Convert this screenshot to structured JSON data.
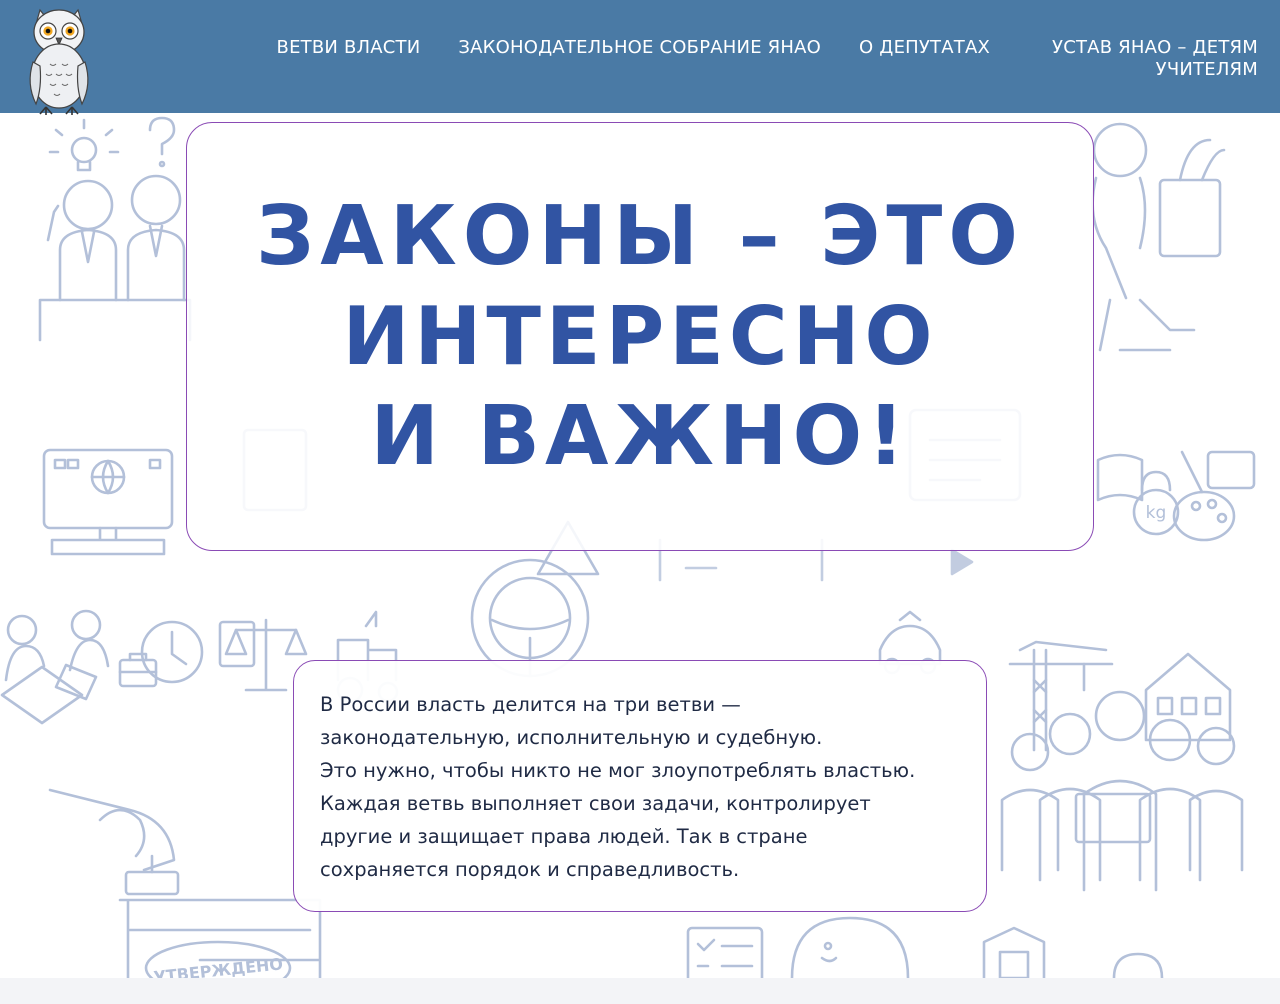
{
  "header": {
    "logo_icon": "owl-mascot-icon",
    "nav": [
      {
        "label": "ВЕТВИ ВЛАСТИ"
      },
      {
        "label": "ЗАКОНОДАТЕЛЬНОЕ СОБРАНИЕ ЯНАО"
      },
      {
        "label": "О ДЕПУТАТАХ"
      },
      {
        "label": "УСТАВ ЯНАО – ДЕТЯМ УЧИТЕЛЯМ"
      }
    ]
  },
  "hero": {
    "title_lines": [
      "ЗАКОНЫ – ЭТО",
      "ИНТЕРЕСНО",
      "И ВАЖНО!"
    ]
  },
  "info": {
    "lines": [
      "В России власть делится на три ветви —",
      "законодательную, исполнительную и судебную.",
      "Это нужно, чтобы никто не мог злоупотреблять властью.",
      "Каждая ветвь выполняет свои задачи, контролирует",
      "другие и защищает права людей. Так в стране",
      "сохраняется порядок и справедливость."
    ]
  },
  "background": {
    "stamp_text": "УТВЕРЖДЕНО",
    "kettlebell_label": "kg"
  },
  "colors": {
    "header_bg": "#4a7aa5",
    "title": "#3154a3",
    "card_border": "#8a4bb5",
    "line_art": "#b3c0d9"
  }
}
